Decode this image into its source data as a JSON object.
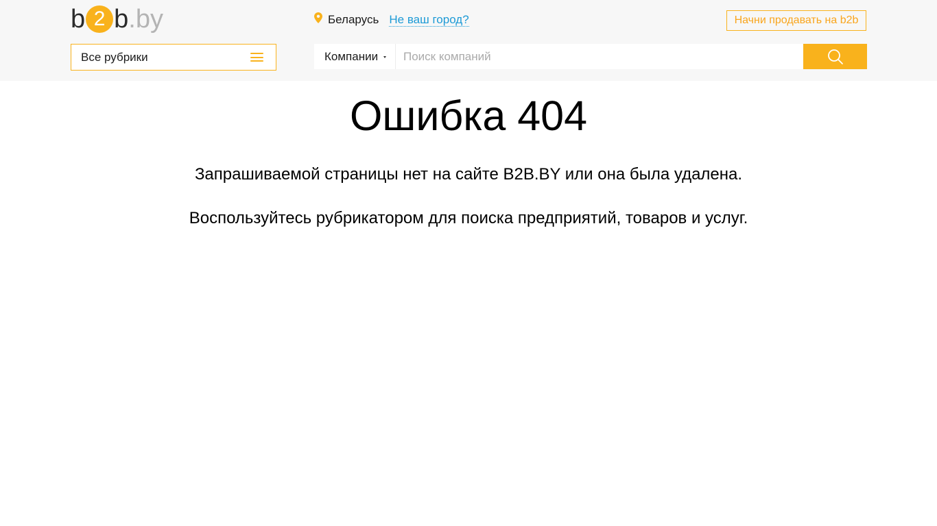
{
  "logo": {
    "part_b1": "b",
    "part_two": "2",
    "part_b2": "b",
    "part_dot": ".",
    "part_by": "by"
  },
  "location": {
    "icon": "map-pin-icon",
    "city": "Беларусь",
    "change_link": "Не ваш город?"
  },
  "header": {
    "sell_button": "Начни продавать на b2b"
  },
  "rubrics": {
    "label": "Все рубрики",
    "icon": "menu-icon"
  },
  "search": {
    "type": "Компании",
    "placeholder": "Поиск компаний",
    "button_icon": "search-icon"
  },
  "main": {
    "title": "Ошибка 404",
    "message1": "Запрашиваемой страницы нет на сайте B2B.BY или она была удалена.",
    "message2": "Воспользуйтесь рубрикатором для поиска предприятий, товаров и услуг."
  },
  "colors": {
    "accent": "#f9b21c",
    "link": "#1c9ad6",
    "header_bg": "#f7f7f7"
  }
}
